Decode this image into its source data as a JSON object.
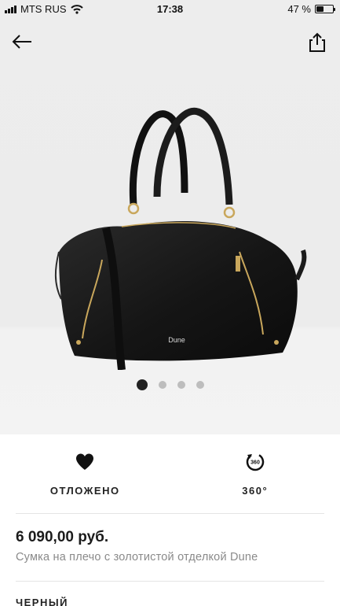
{
  "status_bar": {
    "carrier": "MTS RUS",
    "time": "17:38",
    "battery": "47 %",
    "battery_level": 0.47
  },
  "nav": {
    "back_icon": "arrow-left-icon",
    "share_icon": "share-icon"
  },
  "product_image": {
    "brand_mark": "Dune",
    "carousel": {
      "count": 4,
      "active_index": 0
    }
  },
  "actions": {
    "saved_label": "ОТЛОЖЕНО",
    "saved_icon": "heart-icon",
    "view360_label": "360°",
    "view360_icon": "rotate-360-icon",
    "view360_icon_text": "360"
  },
  "product": {
    "price": "6 090,00 руб.",
    "name": "Сумка на плечо с золотистой отделкой Dune",
    "color": "ЧЕРНЫЙ"
  },
  "colors": {
    "accent": "#222222",
    "muted_text": "#8a8a8a"
  }
}
